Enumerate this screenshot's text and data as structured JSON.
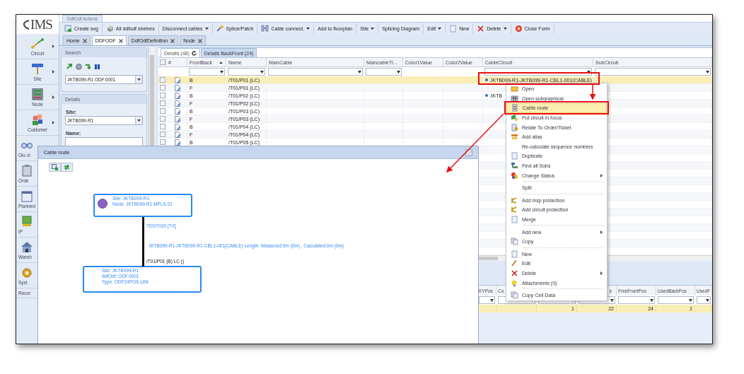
{
  "logo": {
    "text": "IMS"
  },
  "actions_tab": {
    "label": "DdfOdf Actions"
  },
  "toolbar": [
    {
      "label": "Create svg",
      "dropdown": false
    },
    {
      "label": "All ddfodf shelves",
      "dropdown": false
    },
    {
      "label": "Disconnect cables",
      "dropdown": true
    },
    {
      "label": "Splice/Patch",
      "dropdown": false
    },
    {
      "label": "Cable connect.",
      "dropdown": true
    },
    {
      "label": "Add to floorplan",
      "dropdown": false
    },
    {
      "label": "Site",
      "dropdown": true
    },
    {
      "label": "Splicing Diagram",
      "dropdown": false
    },
    {
      "label": "Edit",
      "dropdown": true
    },
    {
      "label": "New",
      "dropdown": false
    },
    {
      "label": "Delete",
      "dropdown": true
    },
    {
      "label": "Close Form",
      "dropdown": false
    }
  ],
  "main_tabs": [
    {
      "label": "Home",
      "selected": false
    },
    {
      "label": "DDFODF",
      "selected": true
    },
    {
      "label": "DdfOdfDefinition",
      "selected": false
    },
    {
      "label": "Node",
      "selected": false
    }
  ],
  "sidebar": {
    "items": [
      {
        "label": "Circuit",
        "submenu": true
      },
      {
        "label": "Site",
        "submenu": true
      },
      {
        "label": "Node",
        "submenu": true
      },
      {
        "label": "Customer",
        "submenu": true
      },
      {
        "label": "Olo ci"
      },
      {
        "label": "Orde"
      },
      {
        "label": "Planned"
      },
      {
        "label": "IP"
      },
      {
        "label": "Wareh"
      },
      {
        "label": "Syst"
      },
      {
        "label": "Recor"
      }
    ]
  },
  "search_panel": {
    "title": "Search",
    "selection": "JKTB099-R1 ODF.0001"
  },
  "details_panel": {
    "title": "Details",
    "fields": [
      {
        "label": "Site:",
        "value": "JKTB099-R1",
        "kind": "dropdown"
      },
      {
        "label": "Name:",
        "kind": "text"
      }
    ]
  },
  "grid": {
    "tabs": [
      {
        "label": "Details (48)",
        "selected": true
      },
      {
        "label": "Details BackFront (24)",
        "selected": false
      }
    ],
    "select_all": {
      "checked": false
    },
    "columns": [
      {
        "label": "#",
        "filter": false,
        "sorted": false
      },
      {
        "label": "FrontBack",
        "filter": true,
        "sorted": true
      },
      {
        "label": "Name",
        "filter": true,
        "sorted": false
      },
      {
        "label": "MainCable",
        "filter": true,
        "sorted": false
      },
      {
        "label": "MaincableTl…",
        "filter": true,
        "sorted": false
      },
      {
        "label": "Color1Value",
        "filter": false,
        "sorted": false
      },
      {
        "label": "Color2Value",
        "filter": false,
        "sorted": false
      },
      {
        "label": "CableCircuit",
        "filter": true,
        "sorted": false
      },
      {
        "label": "SubCircuit",
        "filter": true,
        "sorted": false
      }
    ],
    "rows": [
      {
        "front_back": "B",
        "name": "/T01/P01 (LC)",
        "cable_circuit": "JKTB099-R1-JKTB099-R1-CBL1-001(CABLE)",
        "selected": true
      },
      {
        "front_back": "F",
        "name": "/T01/P01 (LC)",
        "selected": false
      },
      {
        "front_back": "B",
        "name": "/T01/P02 (LC)",
        "cable_circuit": "JKTB",
        "selected": false
      },
      {
        "front_back": "F",
        "name": "/T01/P02 (LC)",
        "selected": false
      },
      {
        "front_back": "B",
        "name": "/T01/P03 (LC)",
        "selected": false
      },
      {
        "front_back": "F",
        "name": "/T01/P03 (LC)",
        "selected": false
      },
      {
        "front_back": "B",
        "name": "/T01/P04 (LC)",
        "selected": false
      },
      {
        "front_back": "F",
        "name": "/T01/P04 (LC)",
        "selected": false
      },
      {
        "front_back": "B",
        "name": "/T01/P05 (LC)",
        "selected": false
      }
    ]
  },
  "bottom_grid": {
    "columns": [
      {
        "label": "KYPos"
      },
      {
        "label": "Co"
      },
      {
        "value": "1"
      },
      {
        "label": "s",
        "value": "22"
      },
      {
        "label": "FreeFrontPos",
        "value": "24"
      },
      {
        "label": "UsedBackPos",
        "value": "2"
      },
      {
        "label": "UsedF"
      }
    ]
  },
  "context_menu": {
    "groups": [
      [
        {
          "label": "Open",
          "highlighted": false,
          "submenu": false
        },
        {
          "label": "Open subgraphical",
          "highlighted": false,
          "submenu": false
        },
        {
          "label": "Cable route",
          "highlighted": true,
          "submenu": false
        },
        {
          "label": "Put circuit in focus",
          "highlighted": false,
          "submenu": false
        },
        {
          "label": "Relate To Order/Ticket",
          "highlighted": false,
          "submenu": false
        },
        {
          "label": "Add alias",
          "highlighted": false,
          "submenu": false
        },
        {
          "label": "Re-calculate sequence numbers",
          "highlighted": false,
          "submenu": false
        },
        {
          "label": "Duplicate",
          "highlighted": false,
          "submenu": false
        },
        {
          "label": "Find all Subs",
          "highlighted": false,
          "submenu": false
        },
        {
          "label": "Change Status",
          "highlighted": false,
          "submenu": true
        }
      ],
      [
        {
          "label": "Split",
          "highlighted": false,
          "submenu": false
        }
      ],
      [
        {
          "label": "Add msp protection",
          "highlighted": false,
          "submenu": false
        },
        {
          "label": "Add circuit protection",
          "highlighted": false,
          "submenu": false
        },
        {
          "label": "Merge",
          "highlighted": false,
          "submenu": false
        }
      ],
      [
        {
          "label": "Add new",
          "highlighted": false,
          "submenu": true
        },
        {
          "label": "Copy",
          "highlighted": false,
          "submenu": false
        }
      ],
      [
        {
          "label": "New",
          "highlighted": false,
          "submenu": false
        },
        {
          "label": "Edit",
          "highlighted": false,
          "submenu": false
        },
        {
          "label": "Delete",
          "highlighted": false,
          "submenu": true
        },
        {
          "label": "Attachments (0)",
          "highlighted": false,
          "submenu": false
        }
      ],
      [
        {
          "label": "Copy Cell Data",
          "highlighted": false,
          "submenu": false
        }
      ]
    ]
  },
  "popup": {
    "title": "Cable route",
    "nodes": [
      {
        "kind": "router",
        "lines": [
          "Site: JKTB099-R1",
          "Node: JKTB099-R1.MPLS.01"
        ]
      },
      {
        "kind": "odf",
        "lines": [
          "Site: JKTB099-R1",
          "ddfOdf: ODF.0001",
          "Type: ODF24POS-UNI"
        ]
      }
    ],
    "link": {
      "port": "TE0/7/0/0 [TX]",
      "cable": "JKTB099-R1-JKTB099-R1-CBL1-001(CABLE) Length: Measured:0m (0m) , Calculated:0m (0m)",
      "end": "/T01/P01 (B) LC ()"
    }
  }
}
